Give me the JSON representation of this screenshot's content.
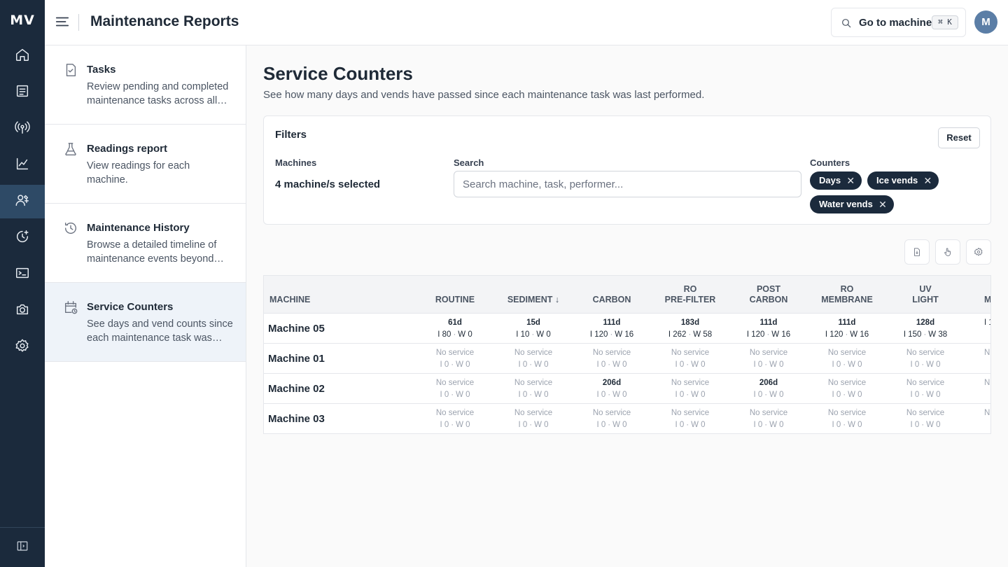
{
  "app": {
    "logo": "MV",
    "title": "Maintenance Reports"
  },
  "header": {
    "goto_label": "Go to machine",
    "shortcut": "⌘ K",
    "avatar_initial": "M"
  },
  "subnav": [
    {
      "title": "Tasks",
      "desc": "Review pending and completed maintenance tasks across all machines.",
      "icon": "clipboard-check-icon"
    },
    {
      "title": "Readings report",
      "desc": "View readings for each machine.",
      "icon": "flask-icon"
    },
    {
      "title": "Maintenance History",
      "desc": "Browse a detailed timeline of maintenance events beyond tasks.",
      "icon": "history-icon"
    },
    {
      "title": "Service Counters",
      "desc": "See days and vend counts since each maintenance task was performed.",
      "icon": "calendar-clock-icon",
      "active": true
    }
  ],
  "main": {
    "title": "Service Counters",
    "subtitle": "See how many days and vends have passed since each maintenance task was last performed."
  },
  "filters": {
    "title": "Filters",
    "reset_label": "Reset",
    "machines_label": "Machines",
    "machines_value": "4 machine/s selected",
    "search_label": "Search",
    "search_placeholder": "Search machine, task, performer...",
    "counters_label": "Counters",
    "chips": [
      "Days",
      "Ice vends",
      "Water vends"
    ]
  },
  "table": {
    "machine_header": "Machine",
    "columns": [
      {
        "line1": "Routine",
        "line2": ""
      },
      {
        "line1": "Sediment ↓",
        "line2": ""
      },
      {
        "line1": "Carbon",
        "line2": ""
      },
      {
        "line1": "RO",
        "line2": "Pre-filter"
      },
      {
        "line1": "Post",
        "line2": "Carbon"
      },
      {
        "line1": "RO",
        "line2": "Membrane"
      },
      {
        "line1": "UV",
        "line2": "Light"
      },
      {
        "line1": "M",
        "line2": ""
      }
    ],
    "rows": [
      {
        "name": "Machine 05",
        "cells": [
          {
            "top": "61d",
            "i": "I 80",
            "w": "W 0",
            "hi": true
          },
          {
            "top": "15d",
            "i": "I 10",
            "w": "W 0",
            "hi": true
          },
          {
            "top": "111d",
            "i": "I 120",
            "w": "W 16",
            "hi": true
          },
          {
            "top": "183d",
            "i": "I 262",
            "w": "W 58",
            "hi": true
          },
          {
            "top": "111d",
            "i": "I 120",
            "w": "W 16",
            "hi": true
          },
          {
            "top": "111d",
            "i": "I 120",
            "w": "W 16",
            "hi": true
          },
          {
            "top": "128d",
            "i": "I 150",
            "w": "W 38",
            "hi": true
          },
          {
            "top": "",
            "i": "I 1",
            "w": "",
            "hi": true
          }
        ]
      },
      {
        "name": "Machine 01",
        "cells": [
          {
            "top": "No service",
            "i": "I 0",
            "w": "W 0"
          },
          {
            "top": "No service",
            "i": "I 0",
            "w": "W 0"
          },
          {
            "top": "No service",
            "i": "I 0",
            "w": "W 0"
          },
          {
            "top": "No service",
            "i": "I 0",
            "w": "W 0"
          },
          {
            "top": "No service",
            "i": "I 0",
            "w": "W 0"
          },
          {
            "top": "No service",
            "i": "I 0",
            "w": "W 0"
          },
          {
            "top": "No service",
            "i": "I 0",
            "w": "W 0"
          },
          {
            "top": "N",
            "i": "",
            "w": ""
          }
        ]
      },
      {
        "name": "Machine 02",
        "cells": [
          {
            "top": "No service",
            "i": "I 0",
            "w": "W 0"
          },
          {
            "top": "No service",
            "i": "I 0",
            "w": "W 0"
          },
          {
            "top": "206d",
            "i": "I 0",
            "w": "W 0",
            "served": true
          },
          {
            "top": "No service",
            "i": "I 0",
            "w": "W 0"
          },
          {
            "top": "206d",
            "i": "I 0",
            "w": "W 0",
            "served": true
          },
          {
            "top": "No service",
            "i": "I 0",
            "w": "W 0"
          },
          {
            "top": "No service",
            "i": "I 0",
            "w": "W 0"
          },
          {
            "top": "N",
            "i": "",
            "w": ""
          }
        ]
      },
      {
        "name": "Machine 03",
        "cells": [
          {
            "top": "No service",
            "i": "I 0",
            "w": "W 0"
          },
          {
            "top": "No service",
            "i": "I 0",
            "w": "W 0"
          },
          {
            "top": "No service",
            "i": "I 0",
            "w": "W 0"
          },
          {
            "top": "No service",
            "i": "I 0",
            "w": "W 0"
          },
          {
            "top": "No service",
            "i": "I 0",
            "w": "W 0"
          },
          {
            "top": "No service",
            "i": "I 0",
            "w": "W 0"
          },
          {
            "top": "No service",
            "i": "I 0",
            "w": "W 0"
          },
          {
            "top": "N",
            "i": "",
            "w": ""
          }
        ]
      }
    ]
  },
  "colors": {
    "rail": "#1b2a3c",
    "rail_active": "#2e4a66",
    "chip": "#1b2a3c",
    "active_subnav": "#eef3f9"
  }
}
